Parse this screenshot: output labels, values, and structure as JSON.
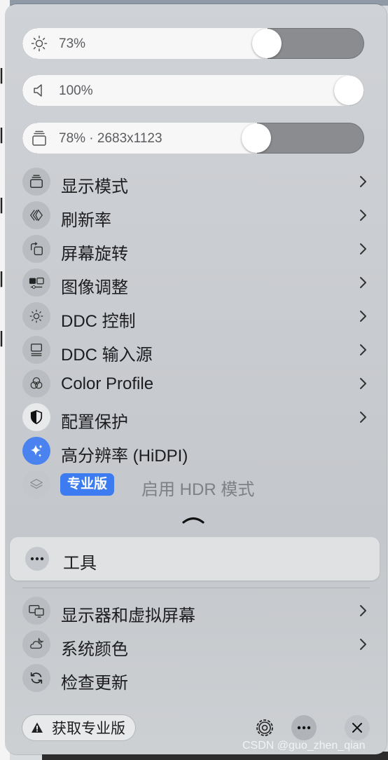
{
  "sliders": {
    "brightness": {
      "label": "73%",
      "value_percent": 73,
      "icon": "brightness-icon"
    },
    "volume": {
      "label": "100%",
      "value_percent": 100,
      "icon": "speaker-icon"
    },
    "resolution": {
      "label": "78% · 2683x1123",
      "value_percent": 78,
      "icon": "display-stack-icon"
    }
  },
  "menu": {
    "items": [
      {
        "label": "显示模式",
        "icon": "display-mode-icon",
        "chevron": true
      },
      {
        "label": "刷新率",
        "icon": "refresh-rate-icon",
        "chevron": true
      },
      {
        "label": "屏幕旋转",
        "icon": "rotate-icon",
        "chevron": true
      },
      {
        "label": "图像调整",
        "icon": "image-adjust-icon",
        "chevron": true
      },
      {
        "label": "DDC 控制",
        "icon": "ddc-control-icon",
        "chevron": true
      },
      {
        "label": "DDC 输入源",
        "icon": "input-source-icon",
        "chevron": true
      },
      {
        "label": "Color Profile",
        "icon": "color-profile-icon",
        "chevron": true
      },
      {
        "label": "配置保护",
        "icon": "shield-icon",
        "chevron": true
      },
      {
        "label": "高分辨率 (HiDPI)",
        "icon": "sparkle-icon",
        "chevron": false
      }
    ],
    "hdr": {
      "badge": "专业版",
      "label": "启用 HDR 模式",
      "icon": "layers-icon"
    }
  },
  "tools": {
    "label": "工具",
    "icon": "more-icon"
  },
  "footer_menu": {
    "items": [
      {
        "label": "显示器和虚拟屏幕",
        "icon": "virtual-display-icon",
        "chevron": true
      },
      {
        "label": "系统颜色",
        "icon": "cloud-moon-icon",
        "chevron": true
      },
      {
        "label": "检查更新",
        "icon": "update-icon",
        "chevron": false
      }
    ]
  },
  "bottom_bar": {
    "get_pro_label": "获取专业版",
    "buttons": [
      "settings-icon",
      "more-icon",
      "close-icon"
    ]
  },
  "watermark": "CSDN @guo_zhen_qian",
  "colors": {
    "accent": "#3d7cf0",
    "slider_track": "#8a8c8f",
    "slider_fill": "#f7f7f8"
  }
}
